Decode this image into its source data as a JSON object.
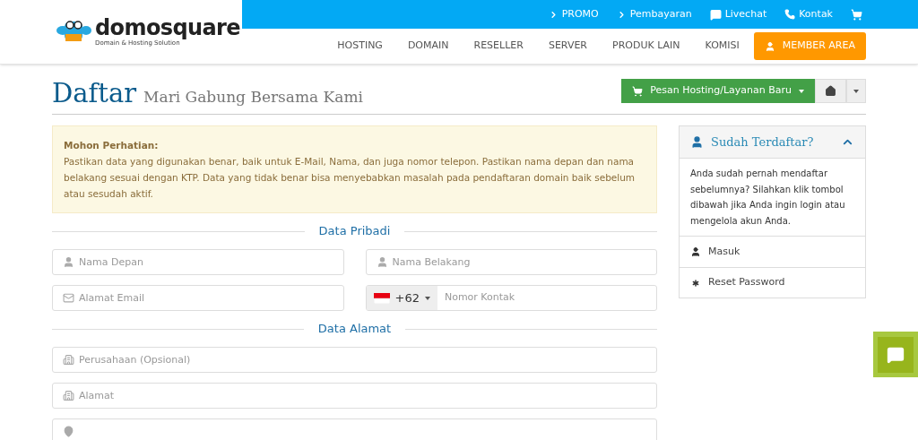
{
  "header": {
    "logo": {
      "name": "domosquare",
      "tagline": "Domain & Hosting Solution"
    },
    "top_links": [
      {
        "label": "PROMO",
        "kind": "chevron"
      },
      {
        "label": "Pembayaran",
        "kind": "chevron"
      },
      {
        "label": "Livechat",
        "kind": "chat"
      },
      {
        "label": "Kontak",
        "kind": "phone"
      },
      {
        "kind": "cart"
      }
    ],
    "nav": [
      "HOSTING",
      "DOMAIN",
      "RESELLER",
      "SERVER",
      "PRODUK LAIN",
      "KOMISI"
    ],
    "member_button": "MEMBER AREA"
  },
  "page": {
    "title": "Daftar",
    "subtitle": "Mari Gabung Bersama Kami",
    "order_button": "Pesan Hosting/Layanan Baru"
  },
  "notice": {
    "title": "Mohon Perhatian:",
    "text": "Pastikan data yang digunakan benar, baik untuk E-Mail, Nama, dan juga nomor telepon. Pastikan nama depan dan nama belakang sesuai dengan KTP. Data yang tidak benar bisa menyebabkan masalah pada pendaftaran domain baik sebelum atau sesudah aktif."
  },
  "sections": [
    {
      "title": "Data Pribadi",
      "fields": [
        {
          "kind": "user",
          "placeholder": "Nama Depan",
          "wide": false
        },
        {
          "kind": "user",
          "placeholder": "Nama Belakang",
          "wide": false
        },
        {
          "kind": "email",
          "placeholder": "Alamat Email",
          "wide": false
        },
        {
          "kind": "phone",
          "prefix": "+62",
          "placeholder": "Nomor Kontak",
          "wide": false
        }
      ]
    },
    {
      "title": "Data Alamat",
      "fields": [
        {
          "kind": "building",
          "placeholder": "Perusahaan (Opsional)",
          "wide": true
        },
        {
          "kind": "building",
          "placeholder": "Alamat",
          "wide": true
        },
        {
          "kind": "pin",
          "wide": true
        }
      ]
    }
  ],
  "sidebar": {
    "title": "Sudah Terdaftar?",
    "expanded": true,
    "text": "Anda sudah pernah mendaftar sebelumnya? Silahkan klik tombol dibawah jika Anda ingin login atau mengelola akun Anda.",
    "items": [
      {
        "kind": "user",
        "label": "Masuk"
      },
      {
        "kind": "asterisk",
        "label": "Reset Password"
      }
    ]
  }
}
